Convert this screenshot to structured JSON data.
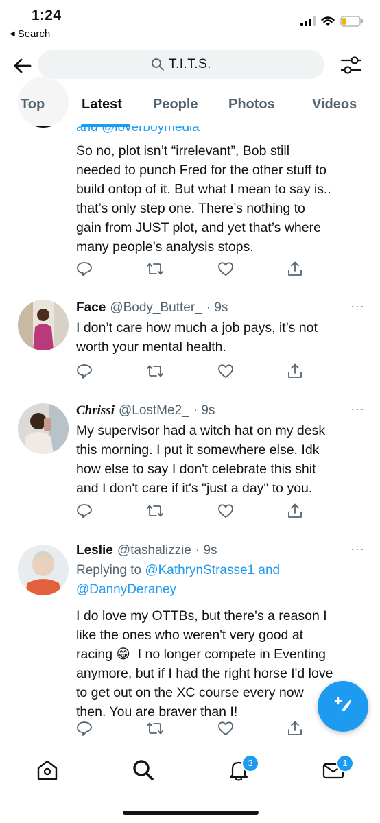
{
  "status": {
    "time": "1:24",
    "back_app": "Search"
  },
  "header": {
    "search_text": "T.I.T.S.",
    "tabs": [
      {
        "label": "Top"
      },
      {
        "label": "Latest"
      },
      {
        "label": "People"
      },
      {
        "label": "Photos"
      },
      {
        "label": "Videos"
      }
    ],
    "active_tab": "Latest"
  },
  "tweets": [
    {
      "reply_partial": "and @loverboymedia",
      "text": "So no, plot isn’t “irrelevant”, Bob still\nneeded to punch Fred for the other stuff to\nbuild ontop of it. But what I mean to say is..\nthat’s only step one. There’s nothing to\ngain from JUST plot, and yet that’s where\nmany people’s analysis stops."
    },
    {
      "name": "Face",
      "handle": "@Body_Butter_",
      "time": "· 9s",
      "text": "I don’t care how much a job pays, it’s not\nworth your mental health."
    },
    {
      "name": "Chrissi",
      "handle": "@LostMe2_",
      "time": "· 9s",
      "text": "My supervisor had a witch hat on my desk\nthis morning. I put it somewhere else. Idk\nhow else to say I don't celebrate this shit\nand I don't care if it's \"just a day\" to you."
    },
    {
      "name": "Leslie",
      "handle": "@tashalizzie",
      "time": "· 9s",
      "replying_prefix": "Replying to",
      "replying_mention1": "@KathrynStrasse1",
      "replying_and": "and",
      "replying_mention2": "@DannyDeraney",
      "text": "I do love my OTTBs, but there's a reason I\nlike the ones who weren't very good at\nracing 😁  I no longer compete in Eventing\nanymore, but if I had the right horse I'd love\nto get out on the XC course every now\nthen. You are braver than I!"
    }
  ],
  "more_label": "···",
  "nav": {
    "notifications_badge": "3",
    "messages_badge": "1"
  },
  "colors": {
    "accent": "#1d9bf0",
    "text": "#0f1419",
    "secondary": "#536471",
    "divider": "#e1e6ea"
  },
  "icons": [
    "back-arrow-icon",
    "search-icon",
    "filter-icon",
    "reply-icon",
    "retweet-icon",
    "like-icon",
    "share-icon",
    "compose-icon",
    "home-icon",
    "explore-icon",
    "notifications-icon",
    "messages-icon",
    "signal-icon",
    "wifi-icon",
    "battery-icon"
  ]
}
